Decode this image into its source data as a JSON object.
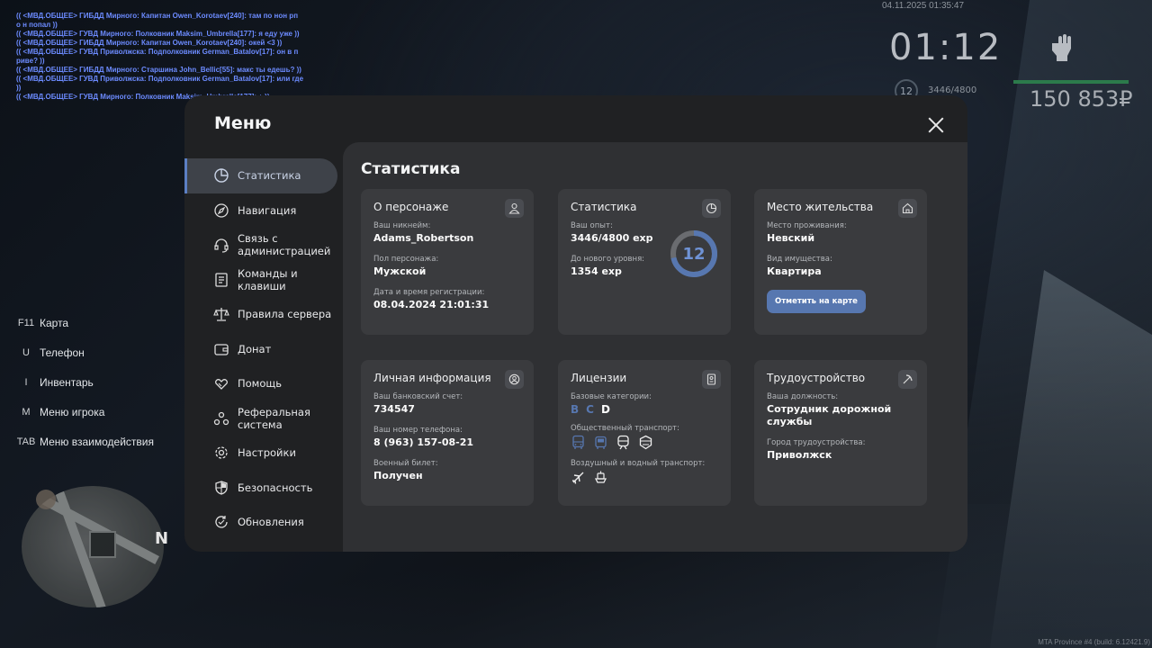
{
  "chat": {
    "lines": [
      "(( <МВД.ОБЩЕЕ> ГИБДД Мирного: Капитан Owen_Korotaev[240]: там по нон рп о н попал ))",
      "(( <МВД.ОБЩЕЕ> ГУВД Мирного: Полковник Maksim_Umbrella[177]: я еду уже ))",
      "(( <МВД.ОБЩЕЕ> ГИБДД Мирного: Капитан Owen_Korotaev[240]: окей <3 ))",
      "(( <МВД.ОБЩЕЕ> ГУВД Приволжска: Подполковник German_Batalov[17]: он в п риве? ))",
      "(( <МВД.ОБЩЕЕ> ГИБДД Мирного: Старшина John_Bellic[55]: макс ты едешь? ))",
      "(( <МВД.ОБЩЕЕ> ГУВД Приволжска: Подполковник German_Batalov[17]: или где ))",
      "(( <МВД.ОБЩЕЕ> ГУВД Мирного: Полковник Maksim_Umbrella[177]: + ))"
    ]
  },
  "hud": {
    "datetime": "04.11.2025 01:35:47",
    "clock": "01:12",
    "level": "12",
    "exp": "3446/4800",
    "money": "150 853₽",
    "health_color": "#2c7a4b"
  },
  "binds": [
    {
      "key": "F11",
      "label": "Карта"
    },
    {
      "key": "U",
      "label": "Телефон"
    },
    {
      "key": "I",
      "label": "Инвентарь"
    },
    {
      "key": "M",
      "label": "Меню игрока"
    },
    {
      "key": "TAB",
      "label": "Меню взаимодействия"
    }
  ],
  "minimap": {
    "north": "N"
  },
  "watermark": "MTA Province #4 (build: 6.12421.9)",
  "menu": {
    "title": "Меню",
    "sidebar": [
      {
        "label": "Статистика",
        "icon": "pie-chart-icon",
        "active": true
      },
      {
        "label": "Навигация",
        "icon": "compass-icon"
      },
      {
        "label": "Связь с администрацией",
        "icon": "headset-icon"
      },
      {
        "label": "Команды и клавиши",
        "icon": "document-icon"
      },
      {
        "label": "Правила сервера",
        "icon": "scales-icon"
      },
      {
        "label": "Донат",
        "icon": "wallet-icon"
      },
      {
        "label": "Помощь",
        "icon": "handshake-icon"
      },
      {
        "label": "Реферальная система",
        "icon": "referral-icon"
      },
      {
        "label": "Настройки",
        "icon": "gear-icon"
      },
      {
        "label": "Безопасность",
        "icon": "shield-icon"
      },
      {
        "label": "Обновления",
        "icon": "refresh-check-icon"
      }
    ],
    "content": {
      "title": "Статистика",
      "character": {
        "title": "О персонаже",
        "nickname_label": "Ваш никнейм:",
        "nickname": "Adams_Robertson",
        "gender_label": "Пол персонажа:",
        "gender": "Мужской",
        "reg_label": "Дата и время регистрации:",
        "reg": "08.04.2024 21:01:31"
      },
      "stats": {
        "title": "Статистика",
        "exp_label": "Ваш опыт:",
        "exp": "3446/4800 exp",
        "next_label": "До нового уровня:",
        "next": "1354 exp",
        "level": "12",
        "progress": 0.718,
        "ring_color": "#5777b0"
      },
      "residence": {
        "title": "Место жительства",
        "place_label": "Место проживания:",
        "place": "Невский",
        "property_label": "Вид имущества:",
        "property": "Квартира",
        "button": "Отметить на карте"
      },
      "personal": {
        "title": "Личная информация",
        "bank_label": "Ваш банковский счет:",
        "bank": "734547",
        "phone_label": "Ваш номер телефона:",
        "phone": "8 (963) 157-08-21",
        "military_label": "Военный билет:",
        "military": "Получен"
      },
      "licenses": {
        "title": "Лицензии",
        "base_label": "Базовые категории:",
        "categories": [
          {
            "letter": "B",
            "color": "#5777b0"
          },
          {
            "letter": "C",
            "color": "#5777b0"
          },
          {
            "letter": "D",
            "color": "#ffffff"
          }
        ],
        "public_label": "Общественный транспорт:",
        "air_label": "Воздушный и водный транспорт:"
      },
      "employment": {
        "title": "Трудоустройство",
        "position_label": "Ваша должность:",
        "position": "Сотрудник дорожной службы",
        "city_label": "Город трудоустройства:",
        "city": "Приволжск"
      }
    }
  }
}
